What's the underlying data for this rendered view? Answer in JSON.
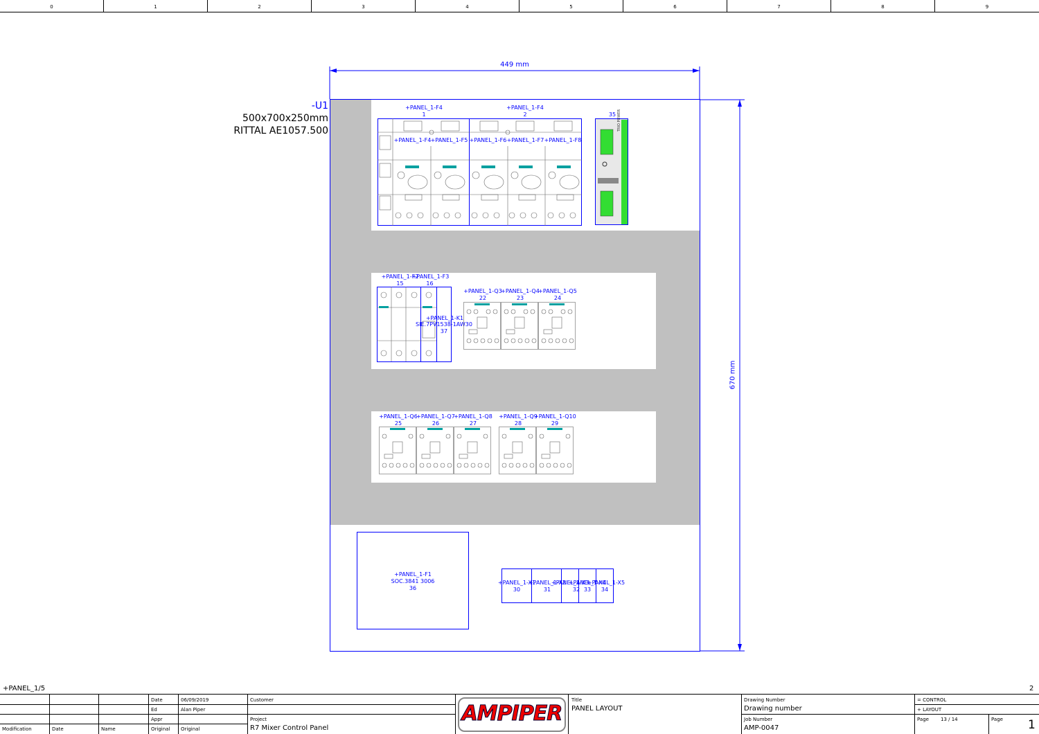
{
  "ruler": [
    "0",
    "1",
    "2",
    "3",
    "4",
    "5",
    "6",
    "7",
    "8",
    "9"
  ],
  "enclosure": {
    "id": "-U1",
    "size": "500x700x250mm",
    "model": "RITTAL AE1057.500",
    "width_dim": "449 mm",
    "height_dim": "670 mm"
  },
  "rail1": {
    "top_labels": [
      {
        "text": "+PANEL_1-F4",
        "num": "1"
      },
      {
        "text": "+PANEL_1-F4",
        "num": "2"
      }
    ],
    "breakers": [
      "+PANEL_1-F4",
      "+PANEL_1-F5",
      "+PANEL_1-F6",
      "+PANEL_1-F7",
      "+PANEL_1-F8"
    ],
    "psu_num": "35",
    "psu_label": "TRIO POWER"
  },
  "rail2": {
    "items": [
      {
        "text": "+PANEL_1-F2",
        "num": "15"
      },
      {
        "text": "+PANEL_1-F3",
        "num": "16"
      },
      {
        "text": "+PANEL_1-Q3",
        "num": "22"
      },
      {
        "text": "+PANEL_1-Q4",
        "num": "23"
      },
      {
        "text": "+PANEL_1-Q5",
        "num": "24"
      }
    ],
    "relay": {
      "text": "+PANEL_1-K1",
      "part": "SIE.7PV1538-1AW30",
      "num": "37"
    }
  },
  "rail3": {
    "items": [
      {
        "text": "+PANEL_1-Q6",
        "num": "25"
      },
      {
        "text": "+PANEL_1-Q7",
        "num": "26"
      },
      {
        "text": "+PANEL_1-Q8",
        "num": "27"
      },
      {
        "text": "+PANEL_1-Q9",
        "num": "28"
      },
      {
        "text": "+PANEL_1-Q10",
        "num": "29"
      }
    ]
  },
  "socket": {
    "text": "+PANEL_1-F1",
    "part": "SOC.3841 3006",
    "num": "36"
  },
  "terminals": [
    {
      "text": "+PANEL_1-X1",
      "num": "30"
    },
    {
      "text": "+PANEL_1-X2",
      "num": "31"
    },
    {
      "text": "+PANEL_1-X3",
      "num": "32"
    },
    {
      "text": "+PANEL_1-X4",
      "num": "33"
    },
    {
      "text": "+PANEL_1-X5",
      "num": "34"
    }
  ],
  "footer": {
    "left_ref": "+PANEL_1/5",
    "right_ref": "2"
  },
  "title_block": {
    "mod_headers": [
      "Modification",
      "Date",
      "Name",
      "Original",
      "Original"
    ],
    "date_label": "Date",
    "date_value": "06/09/2019",
    "ed_label": "Ed",
    "ed_value": "Alan Piper",
    "appr_label": "Appr",
    "customer_label": "Customer",
    "project_label": "Project",
    "project_value": "R7 Mixer Control Panel",
    "logo": "AMPIPER",
    "title_label": "Title",
    "title_value": "PANEL LAYOUT",
    "drawing_number_label": "Drawing Number",
    "drawing_number_value": "Drawing number",
    "job_number_label": "Job Number",
    "job_number_value": "AMP-0047",
    "control_value": "= CONTROL",
    "layout_value": "+ LAYOUT",
    "page_label": "Page",
    "page_value": "13 / 14",
    "page_label2": "Page",
    "page_number": "1"
  }
}
